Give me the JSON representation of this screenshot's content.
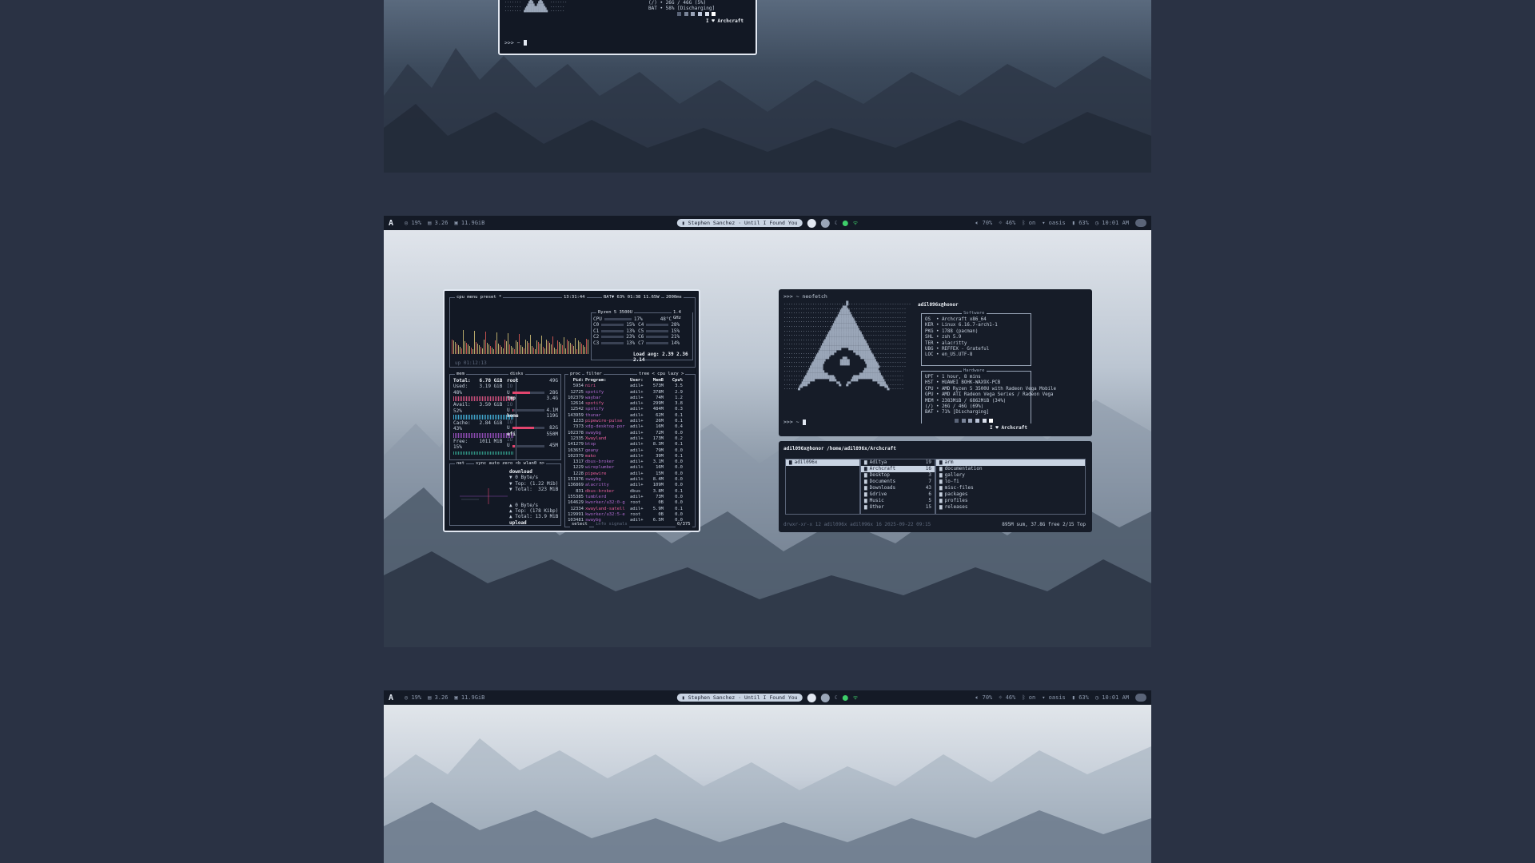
{
  "colors": {
    "accent_pink": "#e2456e",
    "bar_bg": "#141a26",
    "pill_bg": "#c9d4e3"
  },
  "topbar": {
    "logo": "A",
    "cpu": "19%",
    "load": "3.26",
    "disk": "11.9GiB",
    "music": "Stephen Sanchez · Until I Found You",
    "volume": "70%",
    "brightness": "46%",
    "bluetooth": "on",
    "wifi": "oasis",
    "battery": "63%",
    "clock": "10:01 AM"
  },
  "ws1_fetch": {
    "line1": "(/) • 26G / 46G (5%)",
    "line2": "BAT • 58% [Discharging]",
    "footer": "I ♥ Archcraft",
    "prompt": ">>> ~"
  },
  "btop": {
    "cpu_header": "cpu  menu  preset *",
    "clock": "13:31:44",
    "battery": "BAT▼ 63% 01:38 11.65W",
    "refresh": "2000ms",
    "cpu_name": "Ryzen 5 3500U",
    "freq": "1.4 GHz",
    "uptime": "up 01:12:13",
    "cores": [
      {
        "label": "CPU",
        "val": "17%",
        "temp": "48°C"
      },
      {
        "label": "C0",
        "val": "15%"
      },
      {
        "label": "C4",
        "val": "28%"
      },
      {
        "label": "C1",
        "val": "13%"
      },
      {
        "label": "C5",
        "val": "15%"
      },
      {
        "label": "C2",
        "val": "23%"
      },
      {
        "label": "C6",
        "val": "21%"
      },
      {
        "label": "C3",
        "val": "13%"
      },
      {
        "label": "C7",
        "val": "14%"
      }
    ],
    "load_avg": "Load avg: 2.39 2.36 2.14",
    "mem": {
      "title": "mem",
      "total": "Total:   6.78 GiB",
      "used": "Used:    3.19 GiB",
      "used_pct": "48%",
      "avail": "Avail:   3.50 GiB",
      "avail_pct": "52%",
      "cache": "Cache:   2.84 GiB",
      "cache_pct": "43%",
      "free": "Free:    1011 MiB",
      "free_pct": "15%"
    },
    "disks": {
      "title": "disks",
      "rows": [
        {
          "name": "root",
          "size": "49G",
          "used": "28G",
          "pct": 0.57
        },
        {
          "name": "tmp",
          "size": "3.4G",
          "used": "4.1M",
          "pct": 0.01
        },
        {
          "name": "home",
          "size": "119G",
          "used": "82G",
          "pct": 0.69
        },
        {
          "name": "efi",
          "size": "550M",
          "used": "45M",
          "pct": 0.08
        }
      ]
    },
    "net": {
      "title": "net",
      "opts": "sync  auto  zero  <b wlan0 n>",
      "download": "download",
      "dl_rate": "▼ 0 Byte/s",
      "dl_top": "▼ Top: (1.22 Mib)",
      "dl_total": "▼ Total:  323 MiB",
      "ul_rate": "▲ 0 Byte/s",
      "ul_top": "▲ Top: (178 Kibp)",
      "ul_total": "▲ Total: 13.9 MiB",
      "upload": "upload"
    },
    "proc": {
      "title": "proc",
      "filter": "filter",
      "mode": "tree  < cpu lazy >",
      "headers": [
        "Pid:",
        "Program:",
        "User:",
        "MemB",
        "Cpu%"
      ],
      "rows": [
        [
          "5954",
          "niri",
          "adil+",
          "573M",
          "3.5"
        ],
        [
          "12725",
          "spotify",
          "adil+",
          "378M",
          "2.9"
        ],
        [
          "102379",
          "waybar",
          "adil+",
          "74M",
          "1.2"
        ],
        [
          "12614",
          "spotify",
          "adil+",
          "299M",
          "3.8"
        ],
        [
          "12542",
          "spotify",
          "adil+",
          "484M",
          "0.3"
        ],
        [
          "143959",
          "thunar",
          "adil+",
          "62M",
          "0.1"
        ],
        [
          "1233",
          "pipewire-pulse",
          "adil+",
          "26M",
          "0.1"
        ],
        [
          "7373",
          "xdg-desktop-por",
          "adil+",
          "16M",
          "0.4"
        ],
        [
          "102378",
          "swaybg",
          "adil+",
          "72M",
          "0.0"
        ],
        [
          "12335",
          "Xwayland",
          "adil+",
          "173M",
          "0.2"
        ],
        [
          "141279",
          "btop",
          "adil+",
          "8.3M",
          "0.1"
        ],
        [
          "163657",
          "geany",
          "adil+",
          "79M",
          "0.0"
        ],
        [
          "102379",
          "mako",
          "adil+",
          "39M",
          "0.1"
        ],
        [
          "1317",
          "dbus-broker",
          "adil+",
          "3.1M",
          "0.0"
        ],
        [
          "1229",
          "wireplumber",
          "adil+",
          "16M",
          "0.0"
        ],
        [
          "1228",
          "pipewire",
          "adil+",
          "15M",
          "0.0"
        ],
        [
          "151976",
          "swaybg",
          "adil+",
          "8.4M",
          "0.0"
        ],
        [
          "136869",
          "alacritty",
          "adil+",
          "109M",
          "0.0"
        ],
        [
          "831",
          "dbus-broker",
          "dbus",
          "3.8M",
          "0.1"
        ],
        [
          "155385",
          "tumblerd",
          "adil+",
          "73M",
          "0.0"
        ],
        [
          "164629",
          "kworker/u32:0-g",
          "root",
          "0B",
          "0.0"
        ],
        [
          "12334",
          "xwayland-satell",
          "adil+",
          "5.9M",
          "0.1"
        ],
        [
          "129991",
          "kworker/u32:5-e",
          "root",
          "0B",
          "0.0"
        ],
        [
          "103481",
          "swaybg",
          "adil+",
          "6.5M",
          "0.0"
        ]
      ],
      "footer_select": "select",
      "footer_info": "info  signals",
      "footer_count": "0/375"
    }
  },
  "neofetch": {
    "prompt_cmd": ">>> ~ neofetch",
    "userhost": "adil096x@honor",
    "software_label": "Software",
    "hardware_label": "Hardware",
    "software": [
      "OS  • Archcraft x86_64",
      "KER • Linux 6.16.7-arch1-1",
      "PKG • 1788 (pacman)",
      "SHL • zsh 5.9",
      "TER • alacritty",
      "UBG • REFFEX - Grateful",
      "LOC • en_US.UTF-8"
    ],
    "hardware": [
      "UPT • 1 hour, 8 mins",
      "HST • HUAWEI BOHK-WAX9X-PCB",
      "CPU • AMD Ryzen 5 3500U with Radeon Vega Mobile",
      "GPU • AMD ATI Radeon Vega Series / Radeon Vega",
      "MEM • 2383MiB / 6862MiB (34%)",
      "(/) • 26G / 46G (69%)",
      "BAT • 71% [Discharging]"
    ],
    "footer": "I ♥ Archcraft",
    "prompt": ">>> ~"
  },
  "filemanager": {
    "path": "adil096x@honor /home/adil096x/Archcraft",
    "col1": [
      {
        "name": "adil096x",
        "sel": true
      }
    ],
    "col2": [
      {
        "name": "Aditya",
        "count": "19"
      },
      {
        "name": "Archcraft",
        "count": "16",
        "sel": true
      },
      {
        "name": "Desktop",
        "count": "3"
      },
      {
        "name": "Documents",
        "count": "7"
      },
      {
        "name": "Downloads",
        "count": "43"
      },
      {
        "name": "Gdrive",
        "count": "6"
      },
      {
        "name": "Music",
        "count": "5"
      },
      {
        "name": "Other",
        "count": "15"
      }
    ],
    "col3": [
      {
        "name": "arm",
        "sel": true
      },
      {
        "name": "documentation"
      },
      {
        "name": "gallery"
      },
      {
        "name": "lo-fi"
      },
      {
        "name": "misc-files"
      },
      {
        "name": "packages"
      },
      {
        "name": "profiles"
      },
      {
        "name": "releases"
      }
    ],
    "status_left": "drwxr-xr-x 12 adil096x adil096x 16 2025-09-22 09:15",
    "status_right": "895M sum, 37.8G free  2/15  Top"
  }
}
